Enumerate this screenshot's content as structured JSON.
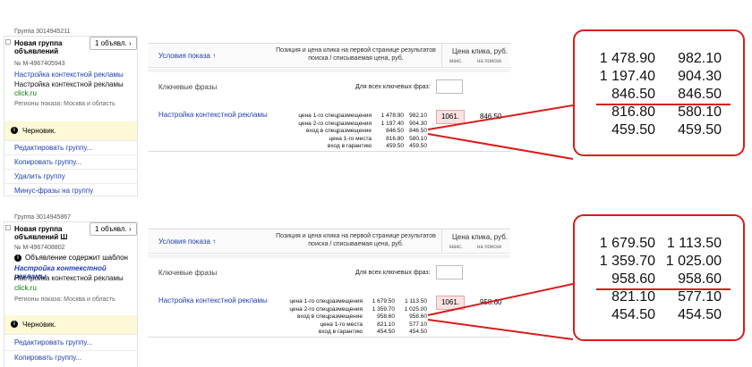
{
  "groups": [
    {
      "group_id": "Группа 3014945211",
      "name": "Новая группа объявлений",
      "ads_count": "1 объявл.",
      "ad_number": "№ М-4967405943",
      "template_warning": "",
      "ad_title": "Настройка контекстной рекламы",
      "ad_text": "Настройка контекстной рекламы",
      "ad_url": "click.ru",
      "regions": "Регионы показа: Москва и область",
      "status": "Черновик.",
      "menu": [
        "Редактировать группу...",
        "Копировать группу...",
        "Удалить группу",
        "Минус-фразы на группу"
      ],
      "table": {
        "col_conditions": "Условия показа ↑",
        "col_position": "Позиция и цена клика на первой странице результатов поиска / списываемая цена, руб.",
        "col_price": "Цена клика, руб.",
        "col_max": "макс.",
        "col_on_search": "на поиске",
        "keywords_label": "Ключевые фразы",
        "all_keywords_label": "Для всех ключевых фраз:",
        "keyword": "Настройка контекстной рекламы",
        "position_labels": [
          "цена 1-го спецразмещения",
          "цена 2-го спецразмещения",
          "вход в спецразмещение",
          "цена 1-го места",
          "вход в гарантию"
        ],
        "prices": [
          "1 478.90",
          "1 197.40",
          "846.50",
          "816.80",
          "459.50"
        ],
        "charged": [
          "982.10",
          "904.30",
          "846.50",
          "580.10",
          "459.50"
        ],
        "max_bid": "1061.",
        "search_price": "846.50"
      }
    },
    {
      "group_id": "Группа 3014945867",
      "name": "Новая группа объявлений Ш",
      "ads_count": "1 объявл.",
      "ad_number": "№ М-4967408802",
      "template_warning": "Объявление содержит шаблон",
      "ad_title": "Настройка контекстной рекламы",
      "ad_text": "Настройка контекстной рекламы",
      "ad_url": "click.ru",
      "regions": "Регионы показа: Москва и область",
      "status": "Черновик.",
      "menu": [
        "Редактировать группу...",
        "Копировать группу..."
      ],
      "table": {
        "col_conditions": "Условия показа ↑",
        "col_position": "Позиция и цена клика на первой странице результатов поиска / списываемая цена, руб.",
        "col_price": "Цена клика, руб.",
        "col_max": "макс.",
        "col_on_search": "на поиске",
        "keywords_label": "Ключевые фразы",
        "all_keywords_label": "Для всех ключевых фраз:",
        "keyword": "Настройка контекстной рекламы",
        "position_labels": [
          "цена 1-го спецразмещения",
          "цена 2-го спецразмещения",
          "вход в спецразмещение",
          "цена 1-го места",
          "вход в гарантию"
        ],
        "prices": [
          "1 679.50",
          "1 359.70",
          "958.60",
          "821.10",
          "454.50"
        ],
        "charged": [
          "1 113.50",
          "1 025.00",
          "958.60",
          "577.10",
          "454.50"
        ],
        "max_bid": "1061.",
        "search_price": "958.60"
      }
    }
  ],
  "zoom": [
    {
      "prices": [
        "1 478.90",
        "1 197.40",
        "846.50",
        "816.80",
        "459.50"
      ],
      "charged": [
        "982.10",
        "904.30",
        "846.50",
        "580.10",
        "459.50"
      ]
    },
    {
      "prices": [
        "1 679.50",
        "1 359.70",
        "958.60",
        "821.10",
        "454.50"
      ],
      "charged": [
        "1 113.50",
        "1 025.00",
        "958.60",
        "577.10",
        "454.50"
      ]
    }
  ],
  "colors": {
    "accent": "#d81c1c",
    "link": "#1f3fb0",
    "url": "#0a7a0a",
    "draft_bg": "#fdf8d6",
    "bid_bg": "#fbe2e2"
  }
}
